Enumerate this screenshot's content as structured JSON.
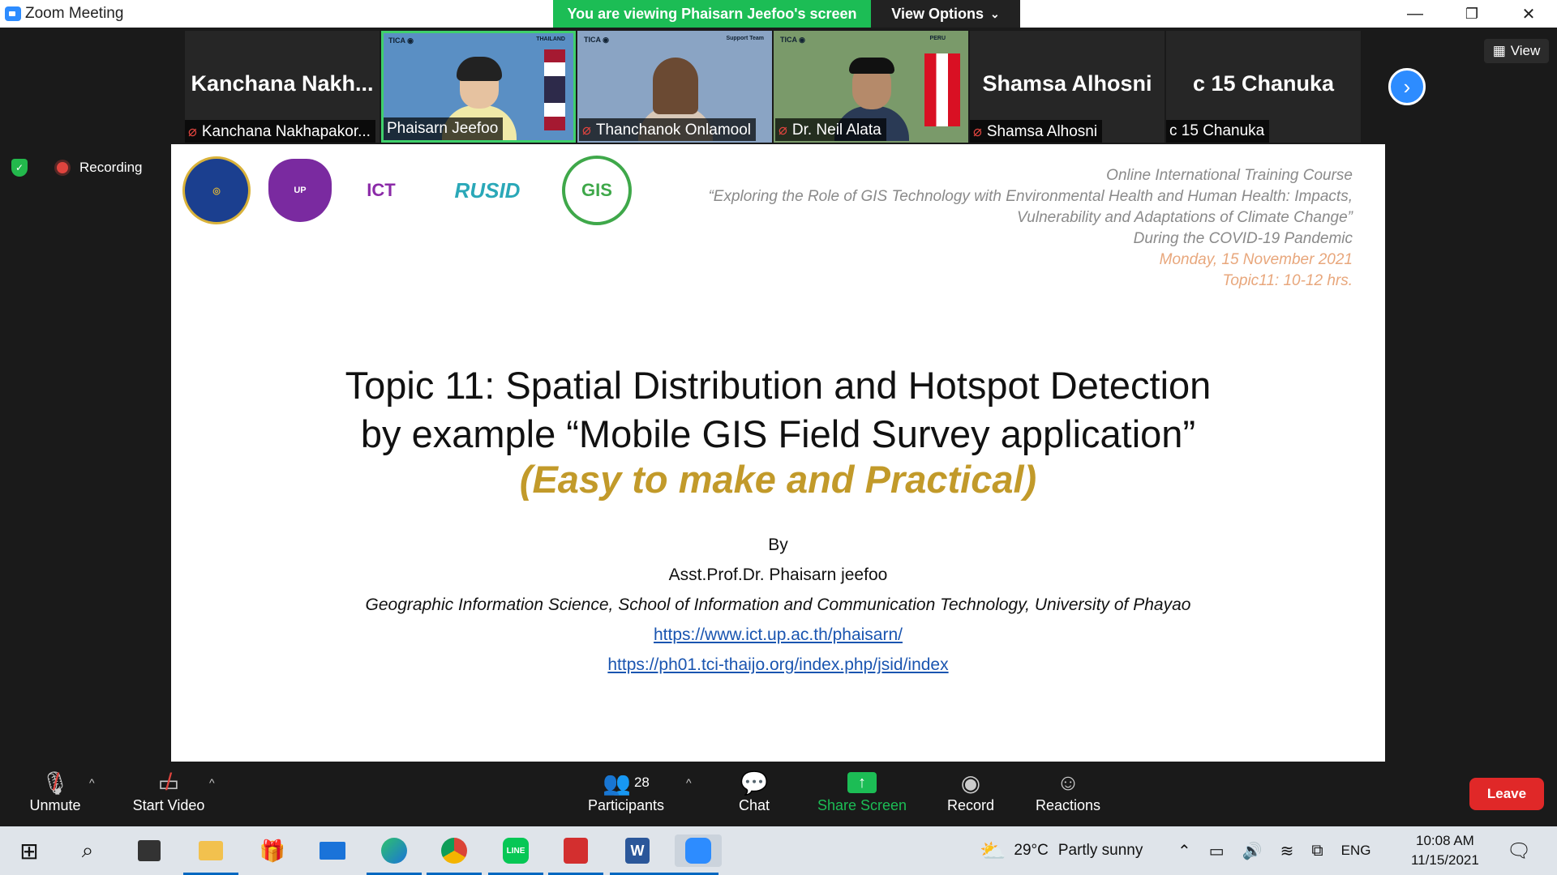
{
  "window": {
    "title": "Zoom Meeting",
    "minimize": "—",
    "restore": "❐",
    "close": "✕"
  },
  "banner": {
    "viewing": "You are viewing Phaisarn Jeefoo's screen",
    "view_options": "View Options",
    "chevron": "⌄"
  },
  "gallery": {
    "tiles": [
      {
        "big_name": "Kanchana  Nakh...",
        "label": "Kanchana Nakhapakor...",
        "muted": true,
        "video": false
      },
      {
        "label": "Phaisarn Jeefoo",
        "muted": false,
        "video": true,
        "tag": "THAILAND"
      },
      {
        "label": "Thanchanok Onlamool",
        "muted": true,
        "video": true,
        "tag": "Support Team"
      },
      {
        "label": "Dr. Neil Alata",
        "muted": true,
        "video": true,
        "tag": "PERU"
      },
      {
        "big_name": "Shamsa Alhosni",
        "label": "Shamsa Alhosni",
        "muted": true,
        "video": false
      },
      {
        "big_name": "c 15 Chanuka",
        "label": "c 15 Chanuka",
        "muted": false,
        "video": false
      }
    ],
    "next_icon": "next-page-icon",
    "view_label": "View"
  },
  "recording": {
    "label": "Recording"
  },
  "slide": {
    "logos": [
      "Mahidol",
      "UP",
      "ICT",
      "RUSID",
      "GIS"
    ],
    "course": {
      "line1": "Online International Training Course",
      "line2": "“Exploring the Role of GIS Technology with Environmental Health and Human Health: Impacts,",
      "line3": "Vulnerability and Adaptations of Climate Change”",
      "line4": "During the COVID-19 Pandemic",
      "date": "Monday, 15 November 2021",
      "time": "Topic11: 10-12 hrs."
    },
    "title_line1": "Topic 11: Spatial Distribution and Hotspot Detection",
    "title_line2": "by example “Mobile GIS Field Survey application”",
    "subtitle": "(Easy to make and Practical)",
    "by": "By",
    "author": "Asst.Prof.Dr. Phaisarn jeefoo",
    "affiliation": "Geographic Information Science, School of Information and Communication Technology, University of Phayao",
    "link1": "https://www.ict.up.ac.th/phaisarn/",
    "link2": "https://ph01.tci-thaijo.org/index.php/jsid/index"
  },
  "toolbar": {
    "unmute": "Unmute",
    "start_video": "Start Video",
    "participants": "Participants",
    "participants_count": "28",
    "chat": "Chat",
    "share_screen": "Share Screen",
    "record": "Record",
    "reactions": "Reactions",
    "leave": "Leave",
    "caret": "^"
  },
  "taskbar": {
    "weather_temp": "29°C",
    "weather_text": "Partly sunny",
    "lang": "ENG",
    "time": "10:08 AM",
    "date": "11/15/2021"
  },
  "colors": {
    "zoom_blue": "#2d8cff",
    "viewing_green": "#1cbd55",
    "leave_red": "#e02828",
    "subtitle_gold": "#c29a2a",
    "course_orange": "#e8a77c"
  }
}
